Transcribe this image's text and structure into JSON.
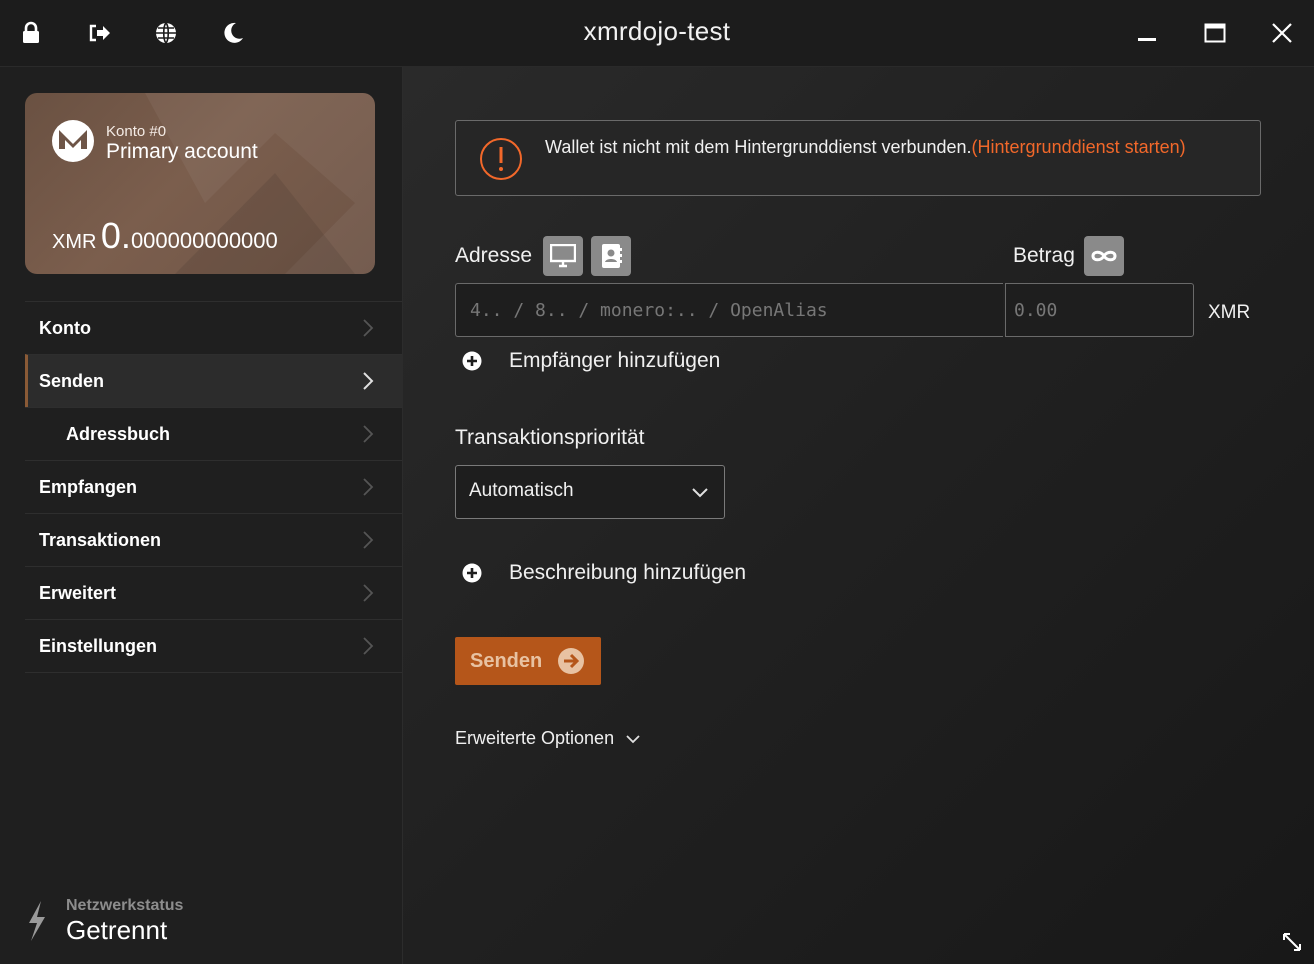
{
  "window": {
    "title": "xmrdojo-test",
    "toolbar_icons": [
      "lock-icon",
      "logout-icon",
      "globe-icon",
      "moon-icon"
    ],
    "controls": [
      "minimize-icon",
      "maximize-icon",
      "close-icon"
    ]
  },
  "account_card": {
    "account_label": "Konto #0",
    "account_name": "Primary account",
    "currency": "XMR",
    "balance_int": "0.",
    "balance_dec": "000000000000"
  },
  "sidebar": {
    "items": [
      {
        "label": "Konto",
        "active": false,
        "sub": false
      },
      {
        "label": "Senden",
        "active": true,
        "sub": false
      },
      {
        "label": "Adressbuch",
        "active": false,
        "sub": true
      },
      {
        "label": "Empfangen",
        "active": false,
        "sub": false
      },
      {
        "label": "Transaktionen",
        "active": false,
        "sub": false
      },
      {
        "label": "Erweitert",
        "active": false,
        "sub": false
      },
      {
        "label": "Einstellungen",
        "active": false,
        "sub": false
      }
    ],
    "network": {
      "label": "Netzwerkstatus",
      "value": "Getrennt"
    }
  },
  "main": {
    "alert": {
      "text": "Wallet ist nicht mit dem Hintergrunddienst verbunden.",
      "link": "(Hintergrunddienst starten)"
    },
    "address_label": "Adresse",
    "amount_label": "Betrag",
    "address_placeholder": "4.. / 8.. / monero:.. / OpenAlias",
    "amount_placeholder": "0.00",
    "amount_unit": "XMR",
    "add_recipient": "Empfänger hinzufügen",
    "priority_label": "Transaktionspriorität",
    "priority_value": "Automatisch",
    "add_description": "Beschreibung hinzufügen",
    "send_button": "Senden",
    "advanced_options": "Erweiterte Optionen"
  },
  "colors": {
    "accent": "#b5561a",
    "alert_link": "#f2682a",
    "card": "#6a5142"
  }
}
